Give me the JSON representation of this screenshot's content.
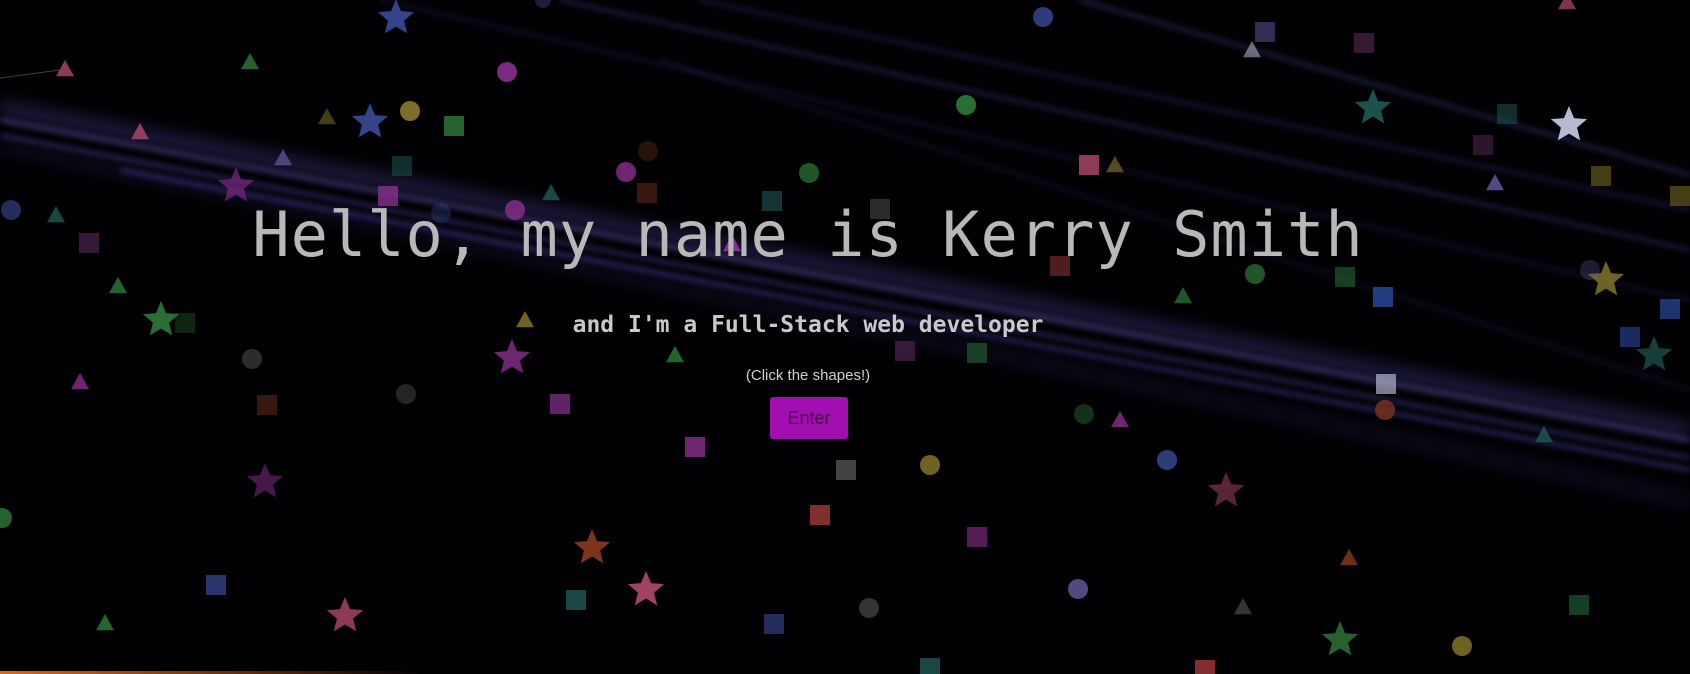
{
  "hero": {
    "headline": "Hello, my name is Kerry Smith",
    "subline": "and I'm a Full-Stack web developer",
    "hint": "(Click the shapes!)",
    "enter_label": "Enter"
  },
  "colors": {
    "background": "#010103",
    "beam": "#7a6cff",
    "enter_button": "#a10fb0",
    "headline_text": "#b8b8b8"
  },
  "background": {
    "beam_count": 10,
    "shape_kinds": [
      "star",
      "circle",
      "square",
      "triangle"
    ],
    "shape_palette": [
      "#3b4a9a",
      "#8a2f8f",
      "#2f7a3a",
      "#8a7a2a",
      "#5a2a5a",
      "#1f5a55",
      "#6a5aa0",
      "#b04a6a",
      "#c8d0e8",
      "#8a3a20",
      "#2a4aa0",
      "#4a4a4a",
      "#1f6a3a",
      "#a03a3a"
    ]
  }
}
